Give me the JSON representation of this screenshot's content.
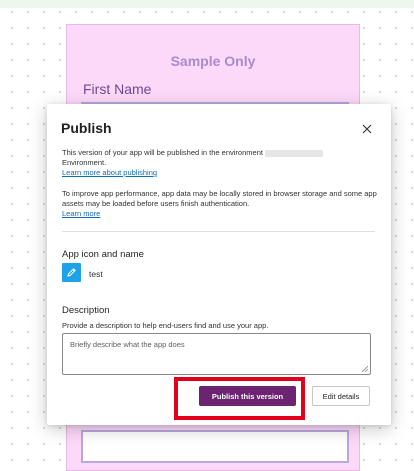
{
  "background_form": {
    "title": "Sample Only",
    "first_name_label": "First Name"
  },
  "dialog": {
    "title": "Publish",
    "close_icon": "close-icon",
    "info_text": "This version of your app will be published in the environment",
    "info_text_tail": "Environment.",
    "learn_more_publishing": "Learn more about publishing",
    "perf_text": "To improve app performance, app data may be locally stored in browser storage and some app assets may be loaded before users finish authentication.",
    "learn_more": "Learn more",
    "app_section_title": "App icon and name",
    "app_icon": "pencil-icon",
    "app_name": "test",
    "description_title": "Description",
    "description_help": "Provide a description to help end-users find and use your app.",
    "description_placeholder": "Briefly describe what the app does",
    "publish_button": "Publish this version",
    "edit_button": "Edit details"
  },
  "colors": {
    "form_background": "#fcd9f8",
    "form_title": "#a78bcf",
    "primary_button": "#6b2372",
    "highlight_border": "#e3001b",
    "link": "#0f6cbd",
    "app_icon_bg": "#1fa3e8"
  }
}
